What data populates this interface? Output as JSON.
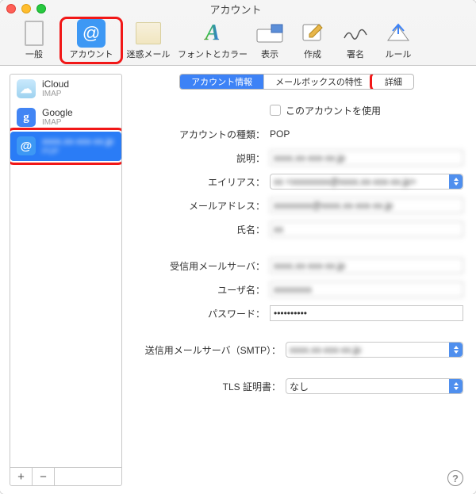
{
  "window": {
    "title": "アカウント"
  },
  "toolbar": {
    "general": "一般",
    "accounts": "アカウント",
    "junk": "迷惑メール",
    "fonts": "フォントとカラー",
    "viewing": "表示",
    "composing": "作成",
    "signatures": "署名",
    "rules": "ルール"
  },
  "sidebar": {
    "items": [
      {
        "name": "iCloud",
        "sub": "IMAP"
      },
      {
        "name": "Google",
        "sub": "IMAP"
      },
      {
        "name": "xxxx.xx-xxx-xx.jp",
        "sub": "POP"
      }
    ]
  },
  "tabs": {
    "info": "アカウント情報",
    "mailbox": "メールボックスの特性",
    "advanced": "詳細"
  },
  "form": {
    "enable_label": "このアカウントを使用",
    "type_label": "アカウントの種類：",
    "type_value": "POP",
    "desc_label": "説明：",
    "desc_value": "xxxx.xx-xxx-xx.jp",
    "alias_label": "エイリアス：",
    "alias_value": "xx <xxxxxxxx@xxxx.xx-xxx-xx.jp>",
    "email_label": "メールアドレス：",
    "email_value": "xxxxxxxx@xxxx.xx-xxx-xx.jp",
    "name_label": "氏名：",
    "name_value": "xx",
    "incoming_label": "受信用メールサーバ：",
    "incoming_value": "xxxx.xx-xxx-xx.jp",
    "user_label": "ユーザ名：",
    "user_value": "xxxxxxxx",
    "pass_label": "パスワード：",
    "pass_value": "••••••••••",
    "smtp_label": "送信用メールサーバ（SMTP）：",
    "smtp_value": "xxxx.xx-xxx-xx.jp",
    "tls_label": "TLS 証明書：",
    "tls_value": "なし"
  }
}
